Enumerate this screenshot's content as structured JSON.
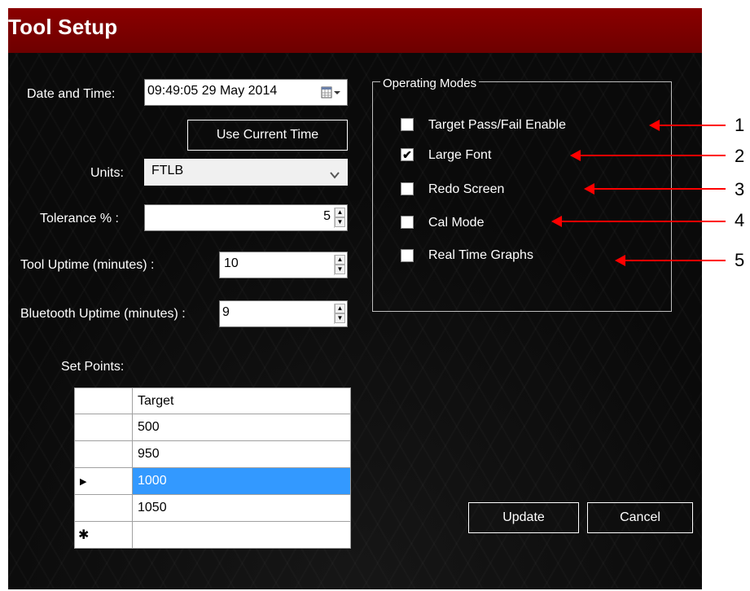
{
  "window": {
    "title": "Tool Setup"
  },
  "form": {
    "date_time_label": "Date and Time:",
    "date_time_value": "09:49:05 29 May 2014",
    "use_current_time_label": "Use Current Time",
    "units_label": "Units:",
    "units_value": "FTLB",
    "tolerance_label": "Tolerance % :",
    "tolerance_value": "5",
    "tool_uptime_label": "Tool Uptime (minutes) :",
    "tool_uptime_value": "10",
    "bluetooth_uptime_label": "Bluetooth Uptime (minutes) :",
    "bluetooth_uptime_value": "9",
    "set_points_label": "Set Points:"
  },
  "set_points": {
    "column_header": "Target",
    "rows": [
      "500",
      "950",
      "1000",
      "1050",
      ""
    ],
    "selected_row_marker": "▶",
    "new_row_marker": "✱"
  },
  "operating_modes": {
    "legend": "Operating Modes",
    "items": [
      {
        "label": "Target Pass/Fail Enable",
        "checked": false
      },
      {
        "label": "Large Font",
        "checked": true
      },
      {
        "label": "Redo Screen",
        "checked": false
      },
      {
        "label": "Cal Mode",
        "checked": false
      },
      {
        "label": "Real Time Graphs",
        "checked": false
      }
    ]
  },
  "buttons": {
    "update": "Update",
    "cancel": "Cancel"
  },
  "annotations": [
    "1",
    "2",
    "3",
    "4",
    "5"
  ],
  "colors": {
    "title_bar": "#7a0000",
    "selection": "#3399ff",
    "annotation_arrow": "#ff0000"
  },
  "icons": {
    "date_picker": "calendar-dropdown-icon",
    "units_dropdown": "chevron-down-icon"
  }
}
